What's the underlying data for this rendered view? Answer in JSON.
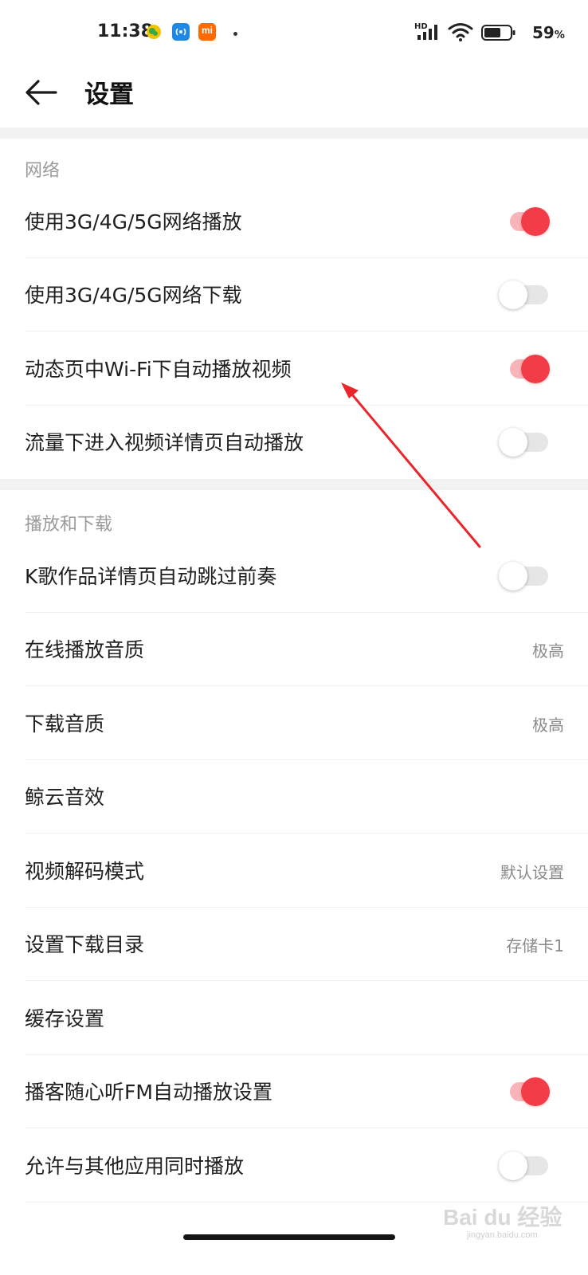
{
  "status_bar": {
    "time": "11:38",
    "network_badge": "HD",
    "battery_value": "59",
    "battery_unit": "%",
    "icons": [
      "wechat-icon",
      "hotspot-icon",
      "mi-icon",
      "signal-icon",
      "wifi-icon",
      "battery-icon"
    ],
    "mi_label": "mi"
  },
  "header": {
    "title": "设置"
  },
  "sections": {
    "network": {
      "title": "网络"
    },
    "playback": {
      "title": "播放和下载"
    }
  },
  "rows": {
    "cellular_play": {
      "label": "使用3G/4G/5G网络播放",
      "toggle_on": true
    },
    "cellular_download": {
      "label": "使用3G/4G/5G网络下载",
      "toggle_on": false
    },
    "wifi_autoplay": {
      "label": "动态页中Wi-Fi下自动播放视频",
      "toggle_on": true
    },
    "data_video_autoplay": {
      "label": "流量下进入视频详情页自动播放",
      "toggle_on": false
    },
    "karaoke_skip_intro": {
      "label": "K歌作品详情页自动跳过前奏",
      "toggle_on": false
    },
    "online_quality": {
      "label": "在线播放音质",
      "value": "极高"
    },
    "download_quality": {
      "label": "下载音质",
      "value": "极高"
    },
    "sound_effect": {
      "label": "鲸云音效"
    },
    "video_decode": {
      "label": "视频解码模式",
      "value": "默认设置"
    },
    "download_dir": {
      "label": "设置下载目录",
      "value": "存储卡1"
    },
    "cache": {
      "label": "缓存设置"
    },
    "podcast_fm": {
      "label": "播客随心听FM自动播放设置",
      "toggle_on": true
    },
    "allow_mix": {
      "label": "允许与其他应用同时播放",
      "toggle_on": false
    }
  },
  "watermark": {
    "text": "Bai du 经验",
    "sub": "jingyan.baidu.com"
  },
  "colors": {
    "accent": "#f23c47",
    "accent_track": "#f7b4b9",
    "annotation": "#e8262c"
  }
}
